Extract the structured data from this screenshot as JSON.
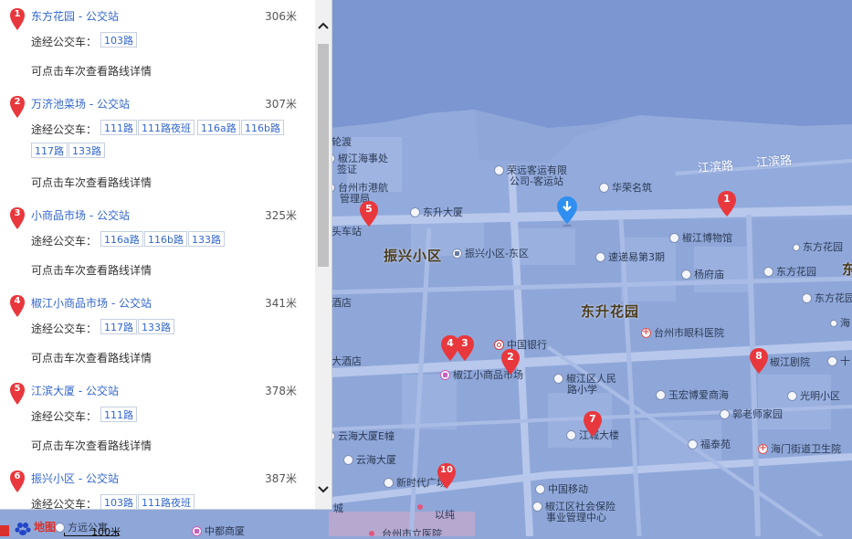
{
  "list": {
    "route_label": "途经公交车：",
    "hint_text": "可点击车次查看路线详情",
    "items": [
      {
        "num": "1",
        "title": "东方花园 - 公交站",
        "distance": "306米",
        "routes": [
          "103路"
        ]
      },
      {
        "num": "2",
        "title": "万济池菜场 - 公交站",
        "distance": "307米",
        "routes": [
          "111路",
          "111路夜班",
          "116a路",
          "116b路",
          "117路",
          "133路"
        ]
      },
      {
        "num": "3",
        "title": "小商品市场 - 公交站",
        "distance": "325米",
        "routes": [
          "116a路",
          "116b路",
          "133路"
        ]
      },
      {
        "num": "4",
        "title": "椒江小商品市场 - 公交站",
        "distance": "341米",
        "routes": [
          "117路",
          "133路"
        ]
      },
      {
        "num": "5",
        "title": "江滨大厦 - 公交站",
        "distance": "378米",
        "routes": [
          "111路"
        ]
      },
      {
        "num": "6",
        "title": "振兴小区 - 公交站",
        "distance": "387米",
        "routes": [
          "103路",
          "111路夜班"
        ]
      }
    ]
  },
  "map": {
    "roads": [
      "江滨路",
      "江滨路"
    ],
    "areas": [
      "振兴小区",
      "东升花园"
    ],
    "edge_text": [
      "东"
    ],
    "pois": [
      "轮渡",
      "椒江海事处",
      "签证",
      "台州市港航",
      "管理局",
      "荣远客运有限",
      "公司-客运站",
      "华荣名筑",
      "东升大厦",
      "头车站",
      "振兴小区-东区",
      "速递易第3期",
      "椒江博物馆",
      "东方花园",
      "杨府庙",
      "东方花园",
      "东方花园",
      "海",
      "大酒店",
      "中国银行",
      "台州市眼科医院",
      "椒江剧院",
      "十",
      "酒店",
      "椒江小商品市场",
      "椒江区人民",
      "路小学",
      "玉宏博爱商海",
      "光明小区",
      "郭老师家园",
      "云海大厦E幢",
      "江城大楼",
      "福泰苑",
      "海门街道卫生院",
      "云海大厦",
      "新时代广场",
      "中国移动",
      "椒江区社会保险",
      "事业管理中心",
      "以纯",
      "城",
      "方远公寓",
      "中都商厦",
      "台州市立医院"
    ],
    "pins": [
      "1",
      "2",
      "3",
      "4",
      "5",
      "7",
      "8",
      "10"
    ]
  },
  "footer": {
    "logo_text": "地图",
    "scale": "100米"
  },
  "colors": {
    "pin": "#e8383d",
    "location": "#2f8ff0",
    "link": "#3366cc",
    "map_bg": "#8fa7d8",
    "sea": "#7b96d1"
  }
}
